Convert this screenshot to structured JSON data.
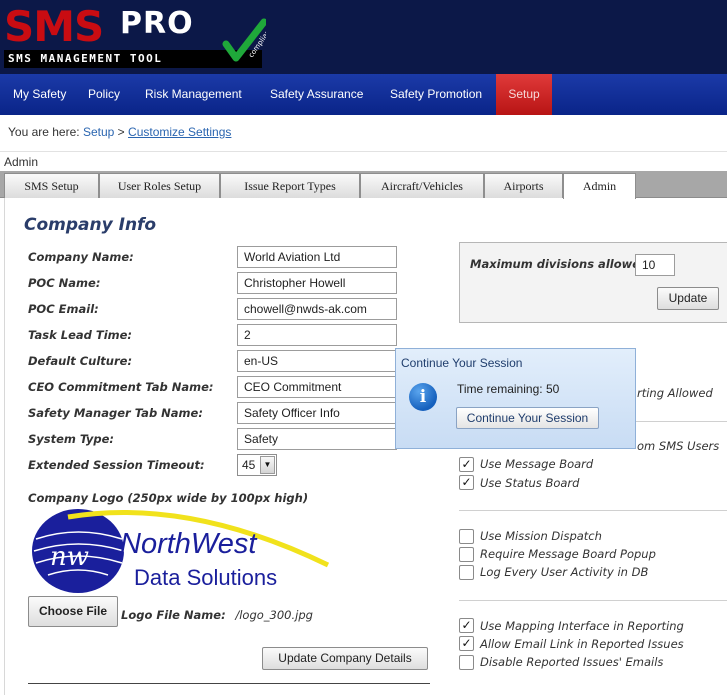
{
  "app": {
    "logo_main": "SMS",
    "logo_pro": "PRO",
    "logo_tagline": "SMS MANAGEMENT TOOL",
    "logo_badge": "compliance"
  },
  "nav": {
    "items": [
      {
        "label": "My Safety"
      },
      {
        "label": "Policy"
      },
      {
        "label": "Risk Management"
      },
      {
        "label": "Safety Assurance"
      },
      {
        "label": "Safety Promotion"
      },
      {
        "label": "Setup",
        "active": true
      }
    ]
  },
  "breadcrumb": {
    "prefix": "You are here:",
    "link1": "Setup",
    "separator": ">",
    "link2": "Customize Settings"
  },
  "section": {
    "label": "Admin"
  },
  "tabs": [
    {
      "label": "SMS Setup"
    },
    {
      "label": "User Roles Setup"
    },
    {
      "label": "Issue Report Types"
    },
    {
      "label": "Aircraft/Vehicles"
    },
    {
      "label": "Airports"
    },
    {
      "label": "Admin",
      "active": true
    }
  ],
  "company": {
    "title": "Company Info",
    "fields": [
      {
        "label": "Company Name:",
        "value": "World Aviation Ltd"
      },
      {
        "label": "POC Name:",
        "value": "Christopher Howell"
      },
      {
        "label": "POC Email:",
        "value": "chowell@nwds-ak.com"
      },
      {
        "label": "Task Lead Time:",
        "value": "2"
      },
      {
        "label": "Default Culture:",
        "value": "en-US"
      },
      {
        "label": "CEO Commitment Tab Name:",
        "value": "CEO Commitment"
      },
      {
        "label": "Safety Manager Tab Name:",
        "value": "Safety Officer Info"
      },
      {
        "label": "System Type:",
        "value": "Safety"
      }
    ],
    "session_timeout_label": "Extended Session Timeout:",
    "session_timeout_value": "45",
    "logo_label": "Company Logo (250px wide by 100px high)",
    "logo_text_line1": "NorthWest",
    "logo_text_line2": "Data Solutions",
    "logo_monogram": "nw",
    "choose_file_label": "Choose File",
    "logo_file_label": "Logo File Name:",
    "logo_file_value": "/logo_300.jpg",
    "update_button": "Update Company Details"
  },
  "divisions": {
    "label": "Maximum divisions allowed",
    "value": "10",
    "update_button": "Update"
  },
  "options": {
    "partial_1": "rting Allowed",
    "partial_2": "om SMS Users",
    "group1": [
      {
        "label": "Use Message Board",
        "checked": true
      },
      {
        "label": "Use Status Board",
        "checked": true
      }
    ],
    "group2": [
      {
        "label": "Use Mission Dispatch",
        "checked": false
      },
      {
        "label": "Require Message Board Popup",
        "checked": false
      },
      {
        "label": "Log Every User Activity in DB",
        "checked": false
      }
    ],
    "group3": [
      {
        "label": "Use Mapping Interface in Reporting",
        "checked": true
      },
      {
        "label": "Allow Email Link in Reported Issues",
        "checked": true
      },
      {
        "label": "Disable Reported Issues' Emails",
        "checked": false
      }
    ]
  },
  "session_dialog": {
    "title": "Continue Your Session",
    "time_label": "Time remaining:",
    "time_value": "50",
    "button": "Continue Your Session",
    "icon": "info-icon"
  },
  "colors": {
    "header_bg": "#0c1848",
    "nav_bg": "#0a2488",
    "nav_active": "#c41e1e",
    "link": "#2a65b0",
    "title": "#2a3d6a"
  }
}
